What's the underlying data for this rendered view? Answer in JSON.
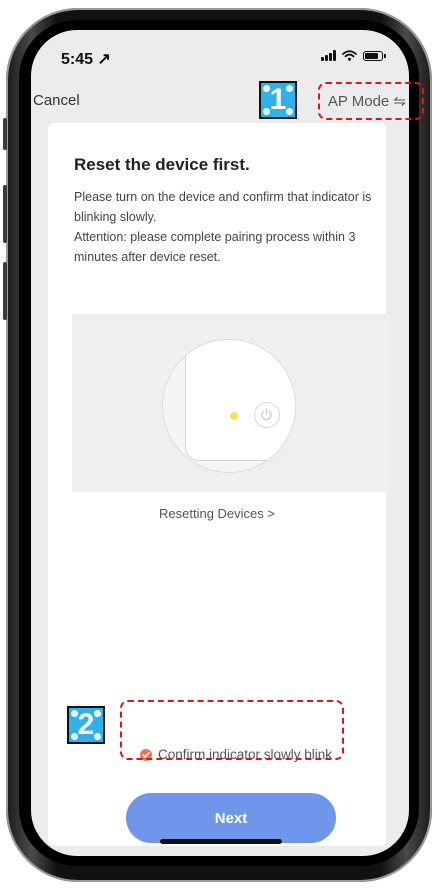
{
  "status_bar": {
    "time": "5:45 ↗"
  },
  "nav": {
    "cancel_label": "Cancel",
    "ap_mode_label": "AP Mode ⇋"
  },
  "card": {
    "title": "Reset the device first.",
    "desc_line1": "Please turn on the device and confirm that indicator is blinking slowly.",
    "desc_line2": "Attention: please complete pairing process within 3 minutes after device reset.",
    "resetting_link": "Resetting Devices >",
    "confirm_label": "Confirm indicator slowly blink",
    "next_label": "Next"
  },
  "annotations": {
    "badge1": "1",
    "badge2": "2"
  },
  "colors": {
    "accent_button": "#6f96ea",
    "check": "#e8774f",
    "annotation_badge": "#2fb2ec",
    "annotation_box": "#e0141b"
  }
}
